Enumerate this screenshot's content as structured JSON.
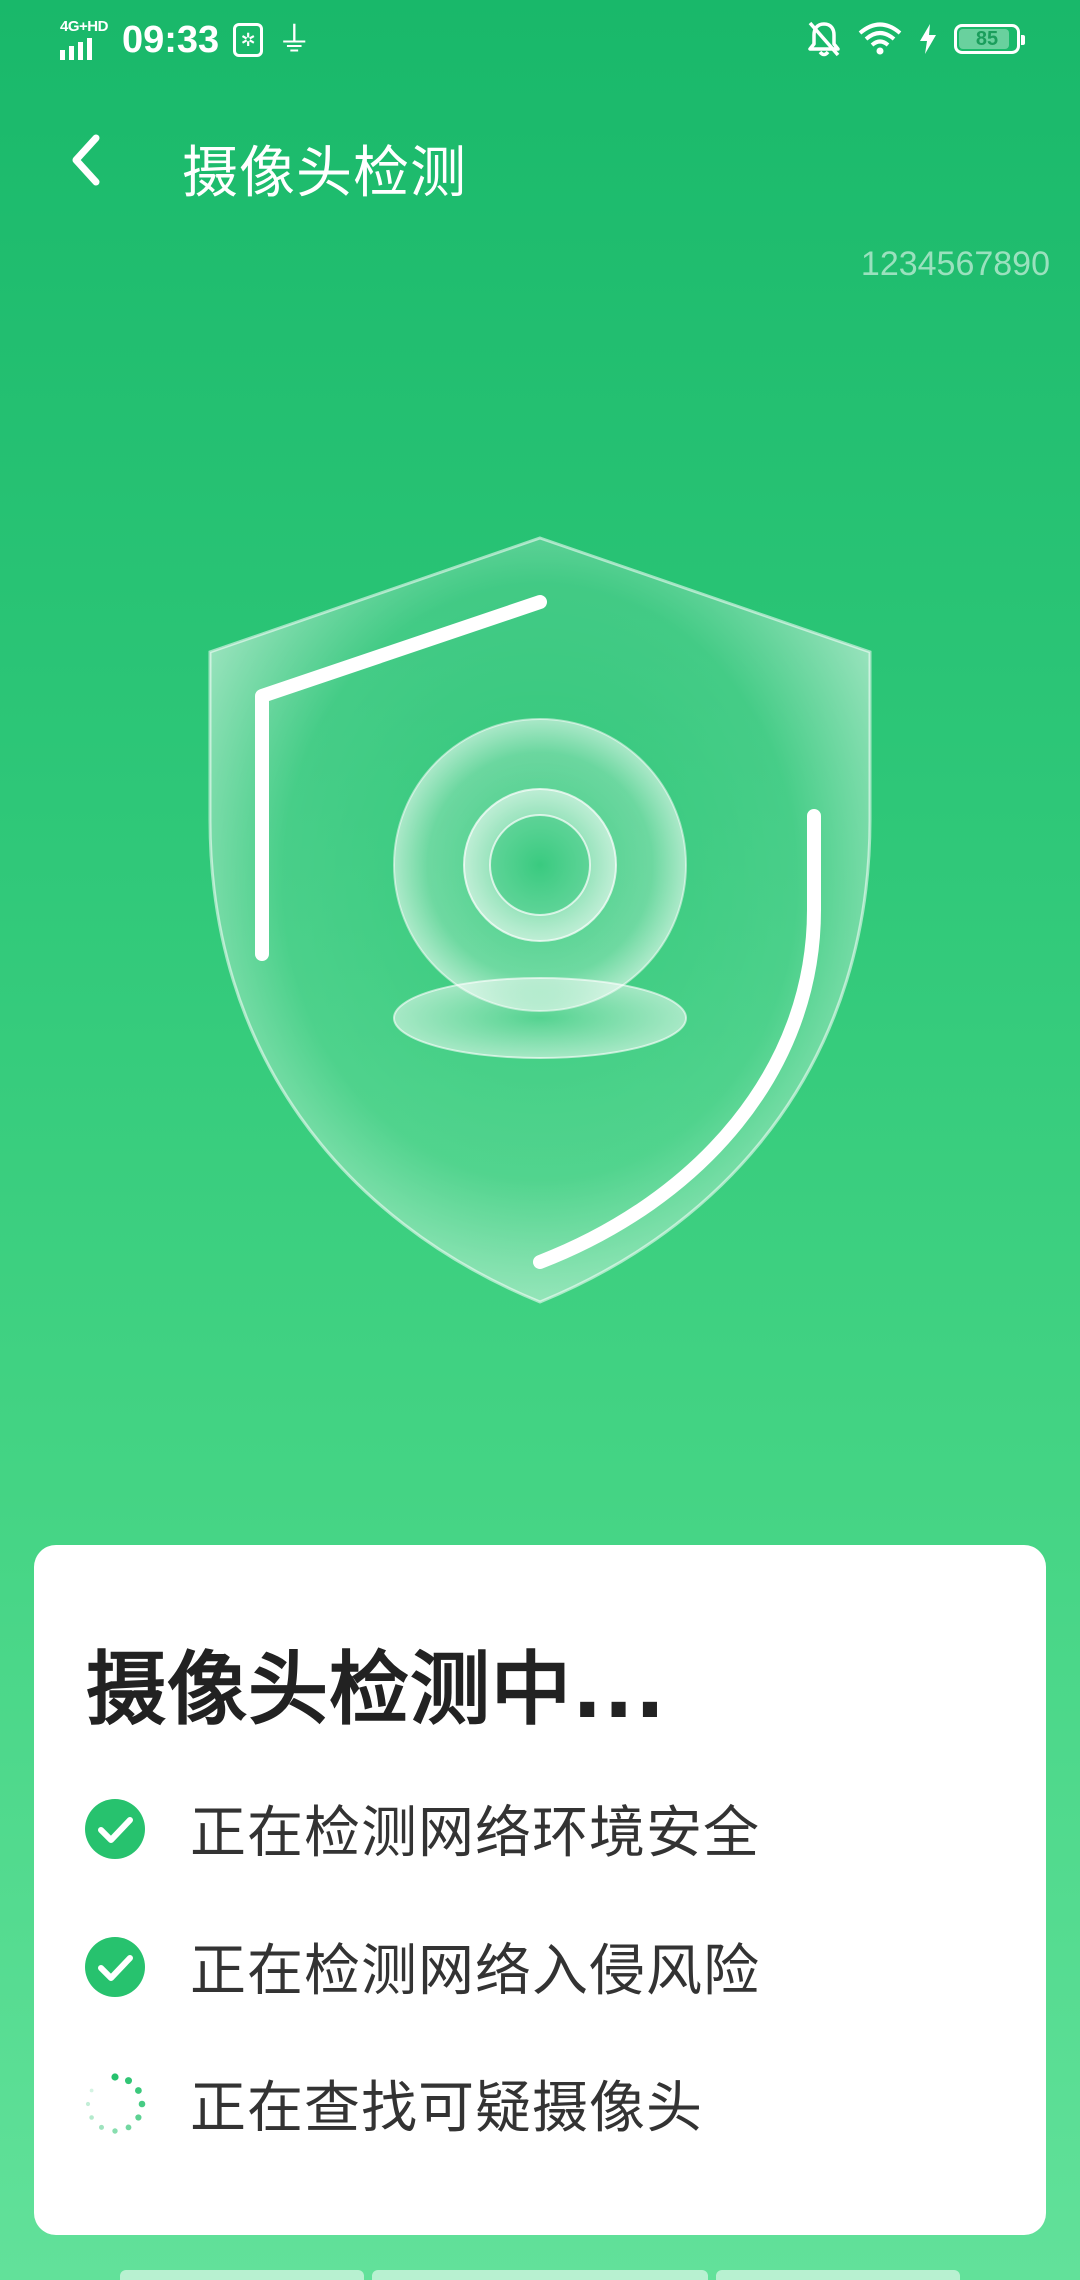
{
  "status_bar": {
    "network": "4G+HD",
    "time": "09:33",
    "battery": "85"
  },
  "header": {
    "title": "摄像头检测",
    "watermark": "1234567890"
  },
  "card": {
    "title": "摄像头检测中...",
    "items": [
      {
        "label": "正在检测网络环境安全",
        "state": "done"
      },
      {
        "label": "正在检测网络入侵风险",
        "state": "done"
      },
      {
        "label": "正在查找可疑摄像头",
        "state": "loading"
      }
    ]
  },
  "colors": {
    "accent": "#2ec778",
    "check": "#27c26e",
    "background_top": "#19b86a",
    "background_bottom": "#62e19a"
  },
  "icons": {
    "back": "chevron-left-icon",
    "check": "check-circle-icon",
    "loading": "spinner-icon",
    "main": "shield-camera-icon"
  }
}
